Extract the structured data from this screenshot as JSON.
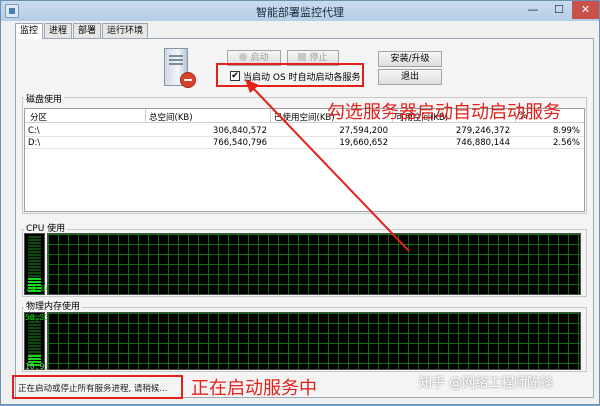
{
  "window": {
    "title": "智能部署监控代理",
    "min_glyph": "—",
    "max_glyph": "☐",
    "close_glyph": "✕"
  },
  "tabs": [
    {
      "label": "监控",
      "active": true
    },
    {
      "label": "进程",
      "active": false
    },
    {
      "label": "部署",
      "active": false
    },
    {
      "label": "运行环境",
      "active": false
    }
  ],
  "controls": {
    "start_label": "启动",
    "stop_label": "停止",
    "install_label": "安装/升级",
    "exit_label": "退出",
    "autostart_label": "当启动 OS 时自动启动各服务",
    "autostart_checked": true,
    "check_glyph": "✔"
  },
  "disk": {
    "title": "磁盘使用",
    "columns": [
      "分区",
      "总空间(KB)",
      "已使用空间(KB)",
      "可用空间(KB)",
      "%"
    ],
    "rows": [
      {
        "partition": "C:\\",
        "total": "306,840,572",
        "used": "27,594,200",
        "free": "279,246,372",
        "pct": "8.99%"
      },
      {
        "partition": "D:\\",
        "total": "766,540,796",
        "used": "19,660,652",
        "free": "746,880,144",
        "pct": "2.56%"
      }
    ]
  },
  "cpu": {
    "title": "CPU 使用",
    "percent_text": "24.04%",
    "fill_fraction": 0.24
  },
  "memory": {
    "title": "物理内存使用",
    "top_text": "50,331,100K",
    "bottom_text": "10,932,240K used",
    "fill_fraction": 0.22
  },
  "status": {
    "text": "正在启动或停止所有服务进程, 请稍候..."
  },
  "annotations": {
    "checkbox_note": "勾选服务器启动自动启动服务",
    "status_note": "正在启动服务中",
    "color": "#e4201b"
  },
  "watermark": "知乎 @网络工程师陈锋"
}
